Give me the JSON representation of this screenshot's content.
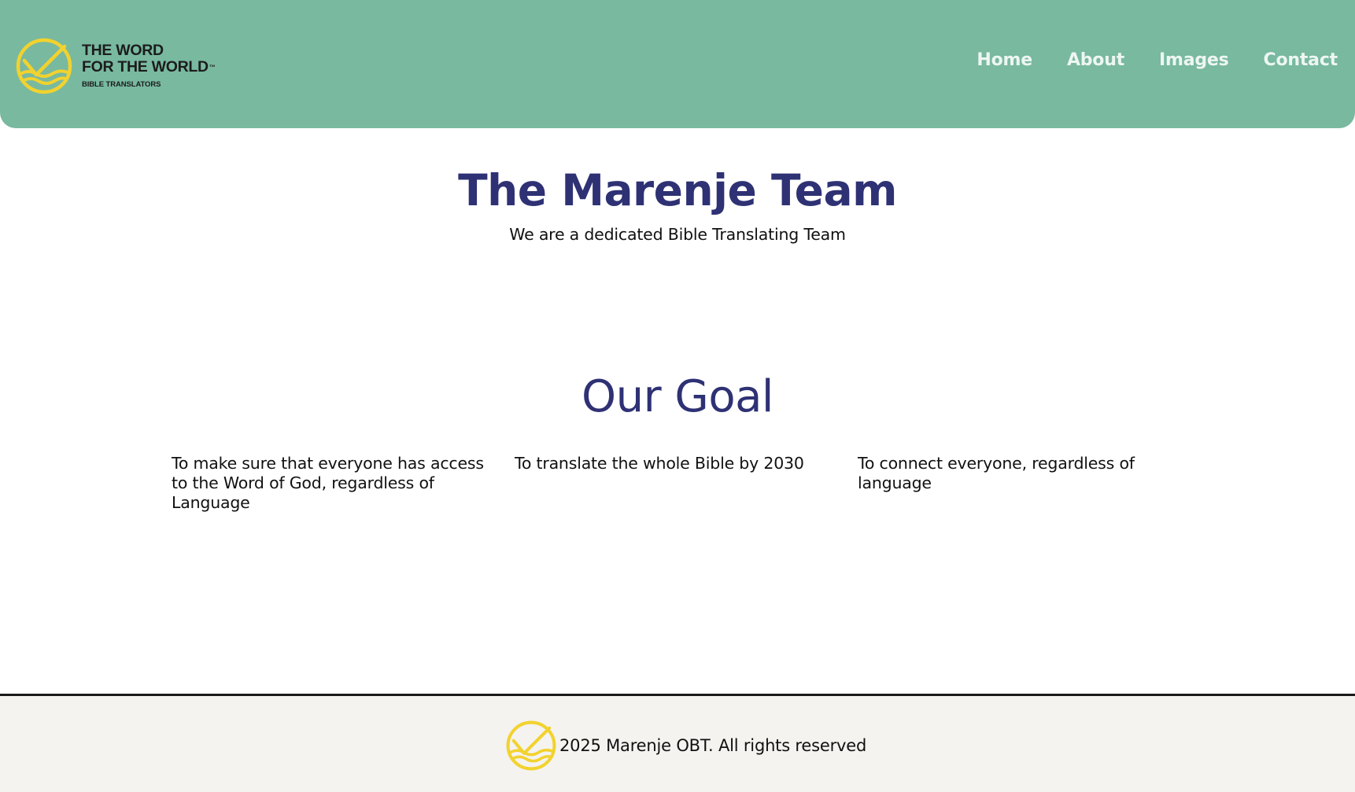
{
  "header": {
    "logo": {
      "line1": "THE WORD",
      "line2": "FOR THE WORLD",
      "trademark": "™",
      "subtitle": "BIBLE TRANSLATORS",
      "icon": "sun-horizon-logo-icon"
    },
    "nav": [
      {
        "label": "Home"
      },
      {
        "label": "About"
      },
      {
        "label": "Images"
      },
      {
        "label": "Contact"
      }
    ]
  },
  "hero": {
    "title": "The Marenje Team",
    "subtitle": "We are a dedicated Bible Translating Team"
  },
  "goal": {
    "title": "Our Goal",
    "items": [
      {
        "text": "To make sure that everyone has access to the Word of God, regardless of Language"
      },
      {
        "text": "To translate the whole Bible by 2030"
      },
      {
        "text": "To connect everyone, regardless of language"
      }
    ]
  },
  "footer": {
    "text": "2025 Marenje OBT. All rights reserved",
    "icon": "sun-horizon-logo-icon"
  },
  "colors": {
    "header_bg": "#78b9a0",
    "nav_text": "#eef6f2",
    "heading": "#2e3173",
    "logo_yellow": "#f2d22e",
    "footer_bg": "#f4f3f0"
  }
}
